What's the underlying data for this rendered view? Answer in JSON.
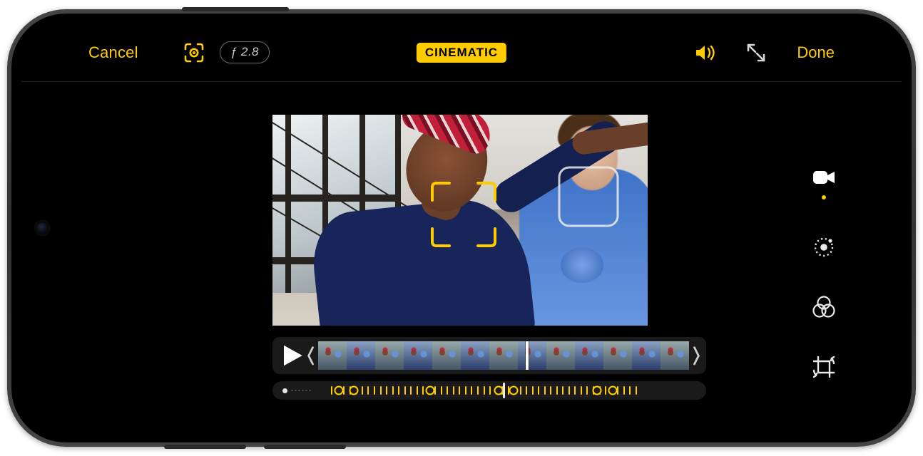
{
  "colors": {
    "accent": "#ffcc00"
  },
  "toolbar": {
    "cancel_label": "Cancel",
    "fstop_label": "ƒ 2.8",
    "mode_label": "CINEMATIC",
    "done_label": "Done",
    "icons": {
      "focus": "focus-brackets-icon",
      "volume": "speaker-icon",
      "fullscreen": "expand-icon"
    }
  },
  "rail": {
    "active_index": 0,
    "tools": [
      {
        "name": "video-tool",
        "label": "Video"
      },
      {
        "name": "adjust-tool",
        "label": "Adjust"
      },
      {
        "name": "filters-tool",
        "label": "Filters"
      },
      {
        "name": "crop-tool",
        "label": "Crop & Rotate"
      }
    ]
  },
  "preview": {
    "primary_focus_subject": "person-foreground",
    "secondary_focus_subject": "person-background"
  },
  "timeline": {
    "state": "paused",
    "thumb_count": 13,
    "playhead_percent": 56,
    "keyframe_percents": [
      6,
      10,
      30,
      48,
      52,
      74,
      78
    ],
    "tick_start_percent": 4,
    "tick_end_percent": 85,
    "tick_spacing_percent": 1.6
  }
}
